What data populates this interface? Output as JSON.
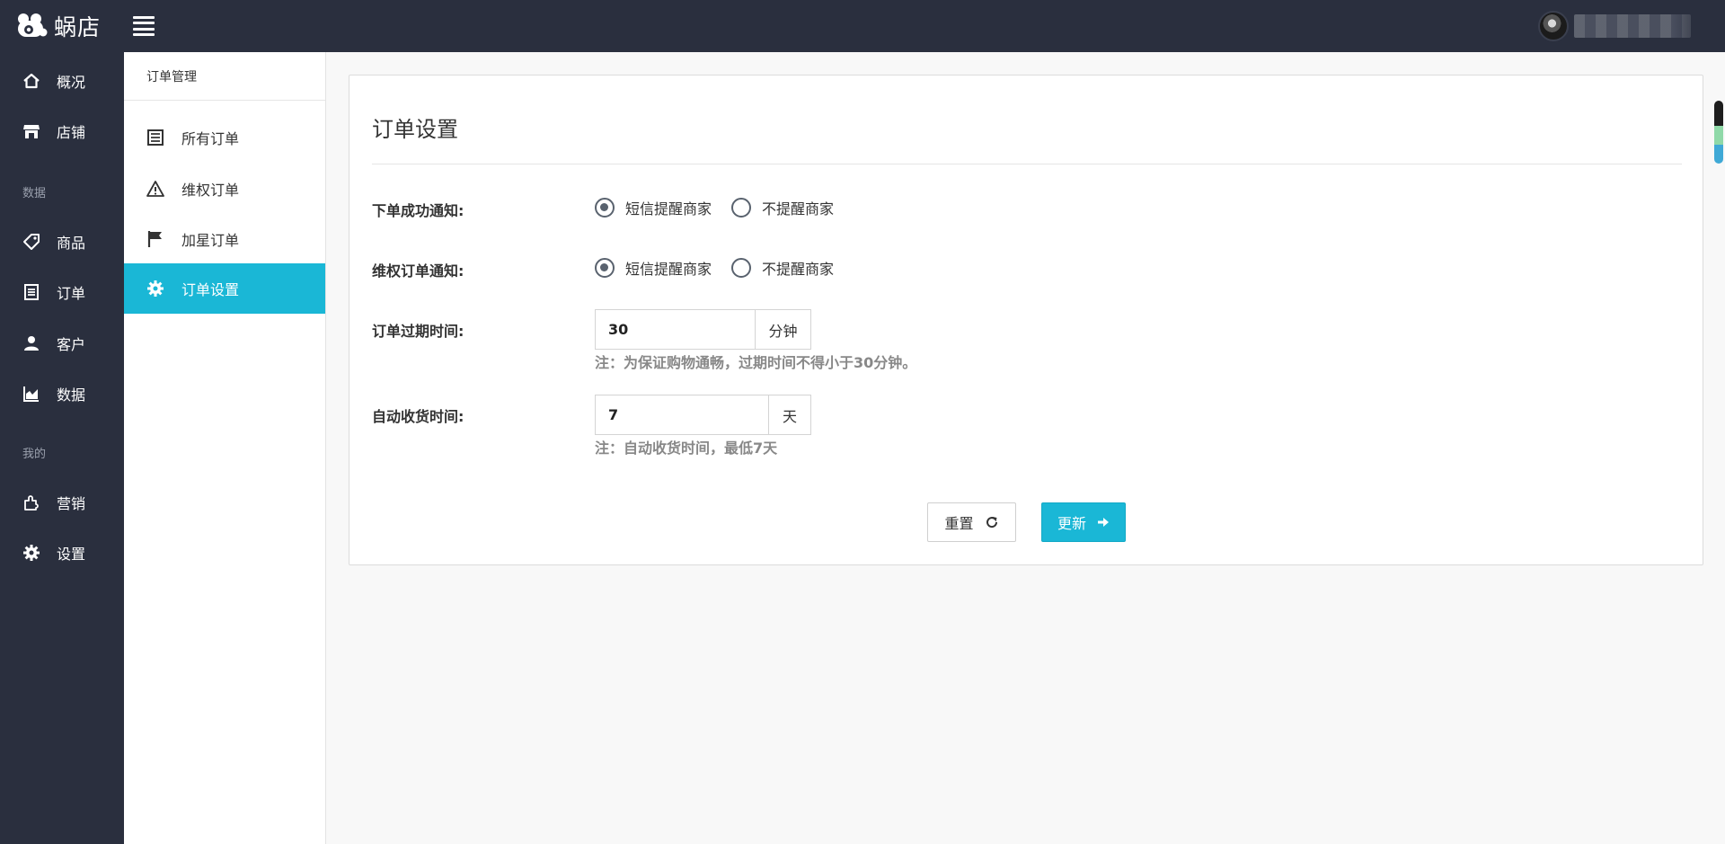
{
  "app": {
    "brand": "蜗店"
  },
  "sidebar": {
    "items": [
      {
        "label": "概况",
        "icon": "home-icon"
      },
      {
        "label": "店铺",
        "icon": "store-icon"
      },
      {
        "label": "商品",
        "icon": "tag-icon"
      },
      {
        "label": "订单",
        "icon": "order-list-icon"
      },
      {
        "label": "客户",
        "icon": "user-icon"
      },
      {
        "label": "数据",
        "icon": "area-chart-icon"
      },
      {
        "label": "营销",
        "icon": "puzzle-icon"
      },
      {
        "label": "设置",
        "icon": "gear-icon"
      }
    ],
    "sections": {
      "data": "数据",
      "mine": "我的"
    }
  },
  "subnav": {
    "title": "订单管理",
    "items": [
      {
        "label": "所有订单",
        "icon": "list-icon"
      },
      {
        "label": "维权订单",
        "icon": "warning-icon"
      },
      {
        "label": "加星订单",
        "icon": "flag-icon"
      },
      {
        "label": "订单设置",
        "icon": "gear-icon",
        "active": true
      }
    ]
  },
  "main": {
    "title": "订单设置",
    "fields": {
      "order_success_notify": {
        "label": "下单成功通知:",
        "options": [
          "短信提醒商家",
          "不提醒商家"
        ],
        "selected": "短信提醒商家"
      },
      "rights_order_notify": {
        "label": "维权订单通知:",
        "options": [
          "短信提醒商家",
          "不提醒商家"
        ],
        "selected": "短信提醒商家"
      },
      "order_expire": {
        "label": "订单过期时间:",
        "value": "30",
        "unit": "分钟",
        "help": "注：为保证购物通畅，过期时间不得小于30分钟。"
      },
      "auto_receive": {
        "label": "自动收货时间:",
        "value": "7",
        "unit": "天",
        "help": "注：自动收货时间，最低7天"
      }
    },
    "buttons": {
      "reset": "重置",
      "update": "更新"
    }
  },
  "colors": {
    "accent": "#1ab7d6",
    "sidebar_bg": "#2a2f3e"
  }
}
